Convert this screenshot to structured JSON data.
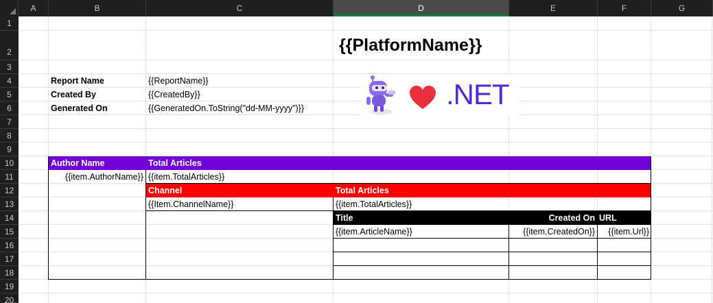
{
  "columns": [
    "A",
    "B",
    "C",
    "D",
    "E",
    "F",
    "G"
  ],
  "selected_column": "D",
  "rows": [
    "1",
    "2",
    "3",
    "4",
    "5",
    "6",
    "7",
    "8",
    "9",
    "10",
    "11",
    "12",
    "13",
    "14",
    "15",
    "16",
    "17",
    "18",
    "19",
    "20"
  ],
  "title": "{{PlatformName}}",
  "report": {
    "report_name_label": "Report Name",
    "report_name_value": "{{ReportName}}",
    "created_by_label": "Created By",
    "created_by_value": "{{CreatedBy}}",
    "generated_on_label": "Generated On",
    "generated_on_value": "{{GeneratedOn.ToString(\"dd-MM-yyyy\")}}"
  },
  "logo": {
    "text": ".NET",
    "heart_icon": "heart-icon",
    "bot_icon": "dotnet-bot-icon",
    "brand_color": "#512bd4",
    "heart_color": "#e8303f"
  },
  "authors_table": {
    "header_author": "Author Name",
    "header_total": "Total Articles",
    "author_value": "{{item.AuthorName}}",
    "total_value": "{{item.TotalArticles}}",
    "header_color": "#6f00d6"
  },
  "channels_table": {
    "header_channel": "Channel",
    "header_total": "Total Articles",
    "channel_value": "{{Item.ChannelName}}",
    "total_value": "{{item.TotalArticles}}",
    "header_color": "#ff0000"
  },
  "articles_table": {
    "header_title": "Title",
    "header_created": "Created On",
    "header_url": "URL",
    "title_value": "{{item.ArticleName}}",
    "created_value": "{{item.CreatedOn}}",
    "url_value": "{{item.Url}}",
    "header_color": "#000000"
  }
}
